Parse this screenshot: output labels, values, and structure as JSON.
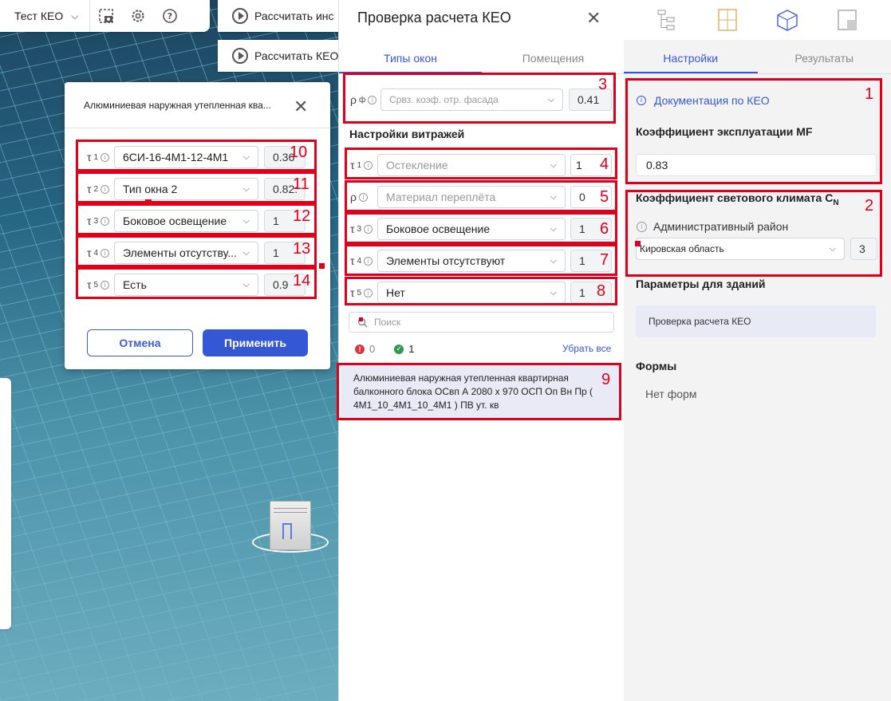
{
  "toolbar": {
    "project": "Тест КЕО",
    "calc_btn_1": "Рассчитать инс",
    "calc_btn_2": "Рассчитать КЕО"
  },
  "dialog": {
    "title": "Алюминиевая наружная утепленная ква...",
    "rows": [
      {
        "label": "τ",
        "sub": "1",
        "value": "6СИ-16-4М1-12-4М1",
        "num": "0.36",
        "badge": "10"
      },
      {
        "label": "τ",
        "sub": "2",
        "value": "Тип окна 2",
        "num": "0.82:",
        "badge": "11"
      },
      {
        "label": "τ",
        "sub": "3",
        "value": "Боковое освещение",
        "num": "1",
        "badge": "12"
      },
      {
        "label": "τ",
        "sub": "4",
        "value": "Элементы отсутству...",
        "num": "1",
        "badge": "13"
      },
      {
        "label": "τ",
        "sub": "5",
        "value": "Есть",
        "num": "0.9",
        "badge": "14"
      }
    ],
    "cancel": "Отмена",
    "apply": "Применить"
  },
  "middle": {
    "title": "Проверка расчета КЕО",
    "tabs": [
      "Типы окон",
      "Помещения"
    ],
    "rho_f": {
      "label": "ρ",
      "sub": "ф",
      "placeholder": "Срвз. коэф. отр. фасада",
      "value": "0.41",
      "badge": "3"
    },
    "stained_header": "Настройки витражей",
    "rows": [
      {
        "label": "τ",
        "sub": "1",
        "value": "Остекление",
        "dim": true,
        "num": "1",
        "badge": "4"
      },
      {
        "label": "ρ",
        "sub": "",
        "value": "Материал переплёта",
        "dim": true,
        "num": "0",
        "badge": "5"
      },
      {
        "label": "τ",
        "sub": "3",
        "value": "Боковое освещение",
        "dim": false,
        "num": "1",
        "badge": "6"
      },
      {
        "label": "τ",
        "sub": "4",
        "value": "Элементы отсутствуют",
        "dim": false,
        "num": "1",
        "badge": "7"
      },
      {
        "label": "τ",
        "sub": "5",
        "value": "Нет",
        "dim": false,
        "num": "1",
        "badge": "8"
      }
    ],
    "search_placeholder": "Поиск",
    "error_count": "0",
    "ok_count": "1",
    "clear_all": "Убрать все",
    "item_text": "Алюминиевая наружная утепленная квартирная балконного блока ОСвп А 2080 х 970 ОСП Оп Вн Пр ( 4М1_10_4М1_10_4М1 ) ПВ ут. кв",
    "item_badge": "9"
  },
  "right": {
    "tabs": [
      "Настройки",
      "Результаты"
    ],
    "doc_link": "Документация по КЕО",
    "mf_label": "Коэффициент эксплуатации MF",
    "mf_value": "0.83",
    "climate_label": "Коэффициент светового климата C",
    "climate_sub": "N",
    "district_label": "Административный район",
    "district_value": "Кировская область",
    "district_num": "3",
    "buildings_label": "Параметры для зданий",
    "building_card": "Проверка расчета КЕО",
    "forms_label": "Формы",
    "forms_empty": "Нет форм",
    "badge1": "1",
    "badge2": "2"
  },
  "colors": {
    "accent": "#3457d5",
    "annotation": "#e0001b"
  }
}
